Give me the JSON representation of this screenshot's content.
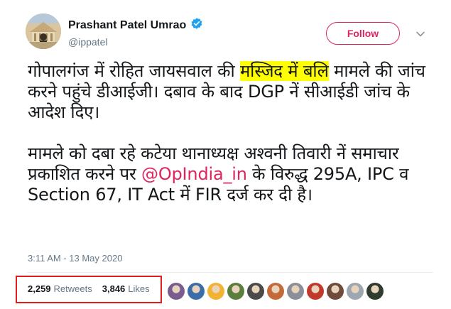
{
  "author": {
    "name": "Prashant Patel Umrao",
    "handle": "@ippatel",
    "verified": true
  },
  "actions": {
    "follow_label": "Follow"
  },
  "tweet": {
    "p1_before": "गोपालगंज में रोहित जायसवाल की ",
    "p1_highlight": "मस्जिद में बलि",
    "p1_after": " मामले की जांच करने पहुंचे डीआईजी। दबाव के बाद DGP नें सीआईडी जांच के आदेश दिए।",
    "p2_before": "मामले को दबा रहे कटेया थानाध्यक्ष अश्वनी तिवारी नें समाचार प्रकाशित करने पर ",
    "p2_mention": "@OpIndia_in",
    "p2_after": " के विरुद्ध 295A, IPC व Section 67, IT Act में FIR दर्ज कर दी है।",
    "timestamp": "3:11 AM - 13 May 2020"
  },
  "stats": {
    "retweets_count": "2,259",
    "retweets_label": "Retweets",
    "likes_count": "3,846",
    "likes_label": "Likes"
  },
  "colors": {
    "accent": "#e0245e",
    "verified": "#1da1f2",
    "highlight": "#ffff00",
    "annotation_box": "#e31d1d"
  },
  "likers": [
    {
      "name": "liker-1-avatar",
      "color": "#7b5c8e"
    },
    {
      "name": "liker-2-avatar",
      "color": "#3b6ea8"
    },
    {
      "name": "liker-3-avatar",
      "color": "#f2b233"
    },
    {
      "name": "liker-4-avatar",
      "color": "#5a7f3c"
    },
    {
      "name": "liker-5-avatar",
      "color": "#4a4a4a"
    },
    {
      "name": "liker-6-avatar",
      "color": "#c46a3a"
    },
    {
      "name": "liker-7-avatar",
      "color": "#8a8f99"
    },
    {
      "name": "liker-8-avatar",
      "color": "#c0392b"
    },
    {
      "name": "liker-9-avatar",
      "color": "#6d4c3d"
    },
    {
      "name": "liker-10-avatar",
      "color": "#9ea7b0"
    },
    {
      "name": "liker-11-avatar",
      "color": "#2f3b2f"
    }
  ]
}
